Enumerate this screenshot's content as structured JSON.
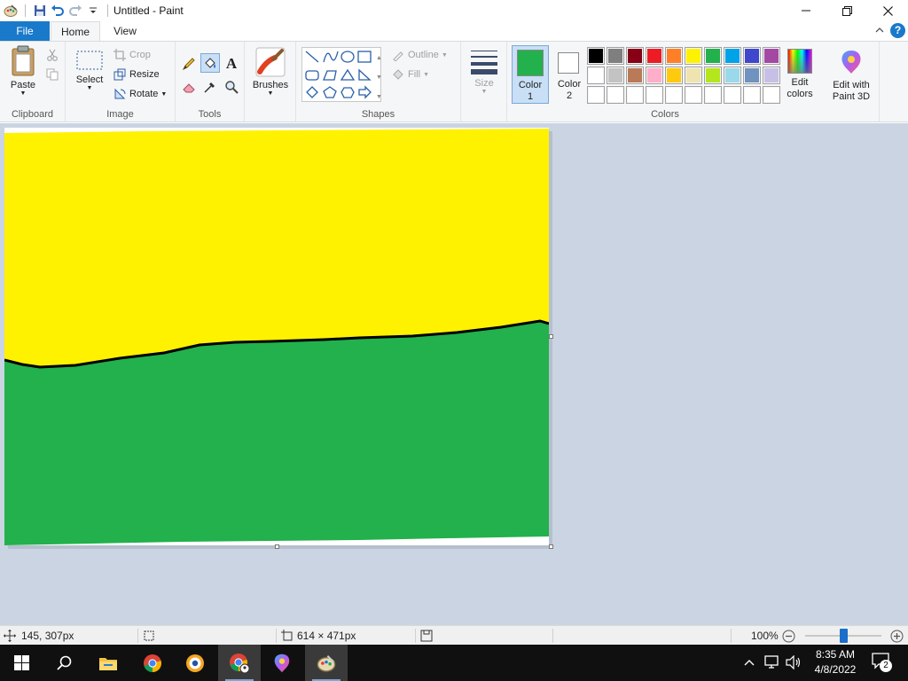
{
  "window": {
    "title": "Untitled - Paint"
  },
  "tabs": {
    "file": "File",
    "home": "Home",
    "view": "View"
  },
  "clipboard": {
    "paste": "Paste",
    "group": "Clipboard"
  },
  "image": {
    "select": "Select",
    "crop": "Crop",
    "resize": "Resize",
    "rotate": "Rotate",
    "group": "Image"
  },
  "tools": {
    "group": "Tools"
  },
  "brushes": {
    "label": "Brushes"
  },
  "shapes": {
    "outline": "Outline",
    "fill": "Fill",
    "group": "Shapes"
  },
  "size": {
    "label": "Size"
  },
  "colors": {
    "color1_label": "Color",
    "color1_num": "1",
    "color2_label": "Color",
    "color2_num": "2",
    "edit_label": "Edit",
    "edit_label2": "colors",
    "paint3d_label": "Edit with",
    "paint3d_label2": "Paint 3D",
    "group": "Colors",
    "color1": "#22b14c",
    "color2": "#ffffff",
    "palette_row1": [
      "#000000",
      "#7f7f7f",
      "#880015",
      "#ed1c24",
      "#ff7f27",
      "#fff200",
      "#22b14c",
      "#00a2e8",
      "#3f48cc",
      "#a349a4"
    ],
    "palette_row2": [
      "#ffffff",
      "#c3c3c3",
      "#b97a57",
      "#ffaec9",
      "#ffc90e",
      "#efe4b0",
      "#b5e61d",
      "#99d9ea",
      "#7092be",
      "#c8bfe7"
    ],
    "palette_row3": [
      "#ffffff",
      "#ffffff",
      "#ffffff",
      "#ffffff",
      "#ffffff",
      "#ffffff",
      "#ffffff",
      "#ffffff",
      "#ffffff",
      "#ffffff"
    ]
  },
  "canvas": {
    "sky_color": "#fff200",
    "grass_color": "#22b14c",
    "line_color": "#000000"
  },
  "status": {
    "cursor_pos": "145, 307px",
    "image_size": "614 × 471px",
    "zoom": "100%",
    "zoom_fraction": 0.5
  },
  "taskbar": {
    "time": "8:35 AM",
    "date": "4/8/2022",
    "notification_count": "2"
  }
}
